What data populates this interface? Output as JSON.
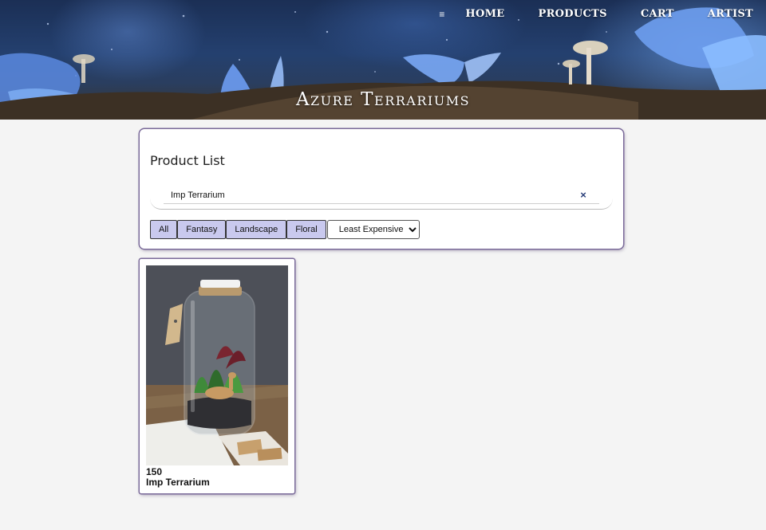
{
  "header": {
    "menu_icon": "≡",
    "nav": [
      {
        "label": "HOME"
      },
      {
        "label": "PRODUCTS"
      },
      {
        "label": "CART"
      },
      {
        "label": "ARTIST"
      }
    ],
    "site_title": "Azure Terrariums"
  },
  "product_list": {
    "title": "Product List",
    "search": {
      "value": "Imp Terrarium",
      "clear_icon": "×"
    },
    "filters": [
      {
        "label": "All"
      },
      {
        "label": "Fantasy"
      },
      {
        "label": "Landscape"
      },
      {
        "label": "Floral"
      }
    ],
    "sort": {
      "selected": "Least Expensive"
    }
  },
  "products": [
    {
      "price": "150",
      "name": "Imp Terrarium",
      "image_icon": "terrarium-jar-image"
    }
  ],
  "colors": {
    "page_bg": "#f4f4f4",
    "panel_border": "#7b6b9a",
    "filter_btn_bg": "#c9c9ee",
    "clear_icon": "#2a3f7a"
  }
}
